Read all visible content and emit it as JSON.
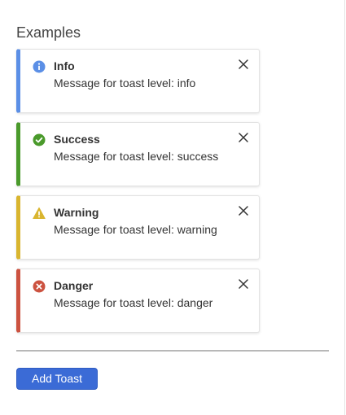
{
  "section": {
    "title": "Examples"
  },
  "toasts": [
    {
      "level": "info",
      "title": "Info",
      "message": "Message for toast level: info",
      "icon": "info-icon",
      "color": "#5b8fe6"
    },
    {
      "level": "success",
      "title": "Success",
      "message": "Message for toast level: success",
      "icon": "check-circle-icon",
      "color": "#4a9a2b"
    },
    {
      "level": "warning",
      "title": "Warning",
      "message": "Message for toast level: warning",
      "icon": "warning-triangle-icon",
      "color": "#d9b52f"
    },
    {
      "level": "danger",
      "title": "Danger",
      "message": "Message for toast level: danger",
      "icon": "error-circle-icon",
      "color": "#cc5240"
    }
  ],
  "actions": {
    "add_toast_label": "Add Toast",
    "button_color": "#3b6bd6"
  }
}
